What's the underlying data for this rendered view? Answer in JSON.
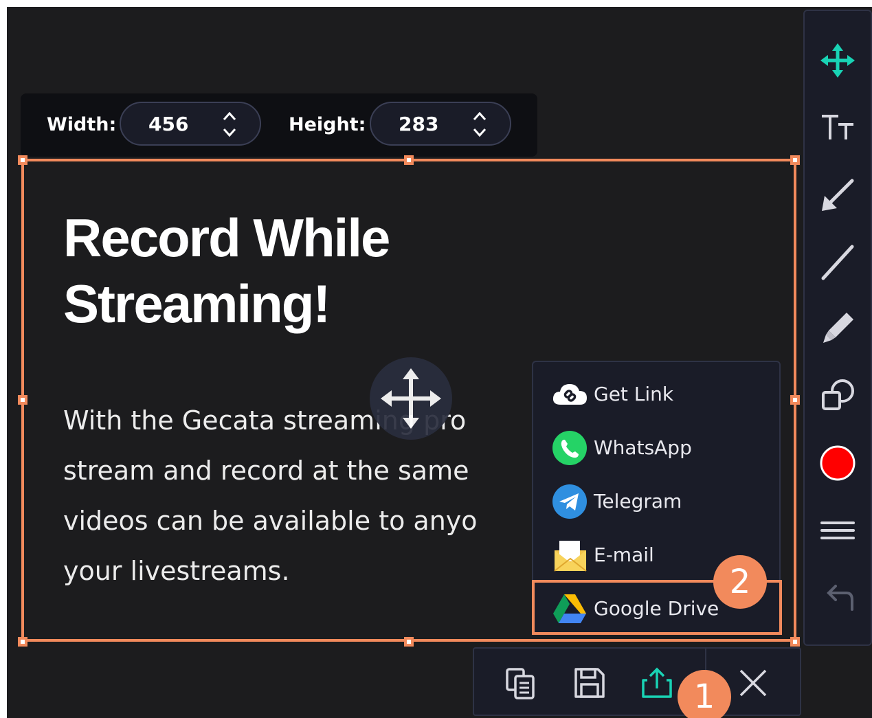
{
  "size_controls": {
    "width_label": "Width:",
    "width_value": "456",
    "height_label": "Height:",
    "height_value": "283"
  },
  "content": {
    "headline_line1": "Record While",
    "headline_line2": "Streaming!",
    "body_lines": [
      "With the Gecata streaming pro",
      "stream and record at the same",
      "videos can be available to anyo",
      "your livestreams."
    ]
  },
  "share_menu": {
    "items": [
      {
        "label": "Get Link",
        "icon": "cloud-link-icon"
      },
      {
        "label": "WhatsApp",
        "icon": "whatsapp-icon"
      },
      {
        "label": "Telegram",
        "icon": "telegram-icon"
      },
      {
        "label": "E-mail",
        "icon": "email-icon"
      },
      {
        "label": "Google Drive",
        "icon": "google-drive-icon"
      }
    ]
  },
  "toolbar": {
    "tools": [
      "move-icon",
      "text-size-icon",
      "arrow-icon",
      "line-icon",
      "marker-icon",
      "shapes-icon",
      "color-icon",
      "line-width-icon",
      "undo-icon"
    ],
    "accent_color": "#19d3b5",
    "selected_color": "#ff0000"
  },
  "bottom_bar": {
    "buttons": [
      "copy-icon",
      "save-icon",
      "share-icon",
      "close-icon"
    ]
  },
  "badges": {
    "step1": "1",
    "step2": "2"
  },
  "colors": {
    "highlight": "#f28a5c",
    "background": "#1c1c1e",
    "panel": "#1a1c28"
  }
}
